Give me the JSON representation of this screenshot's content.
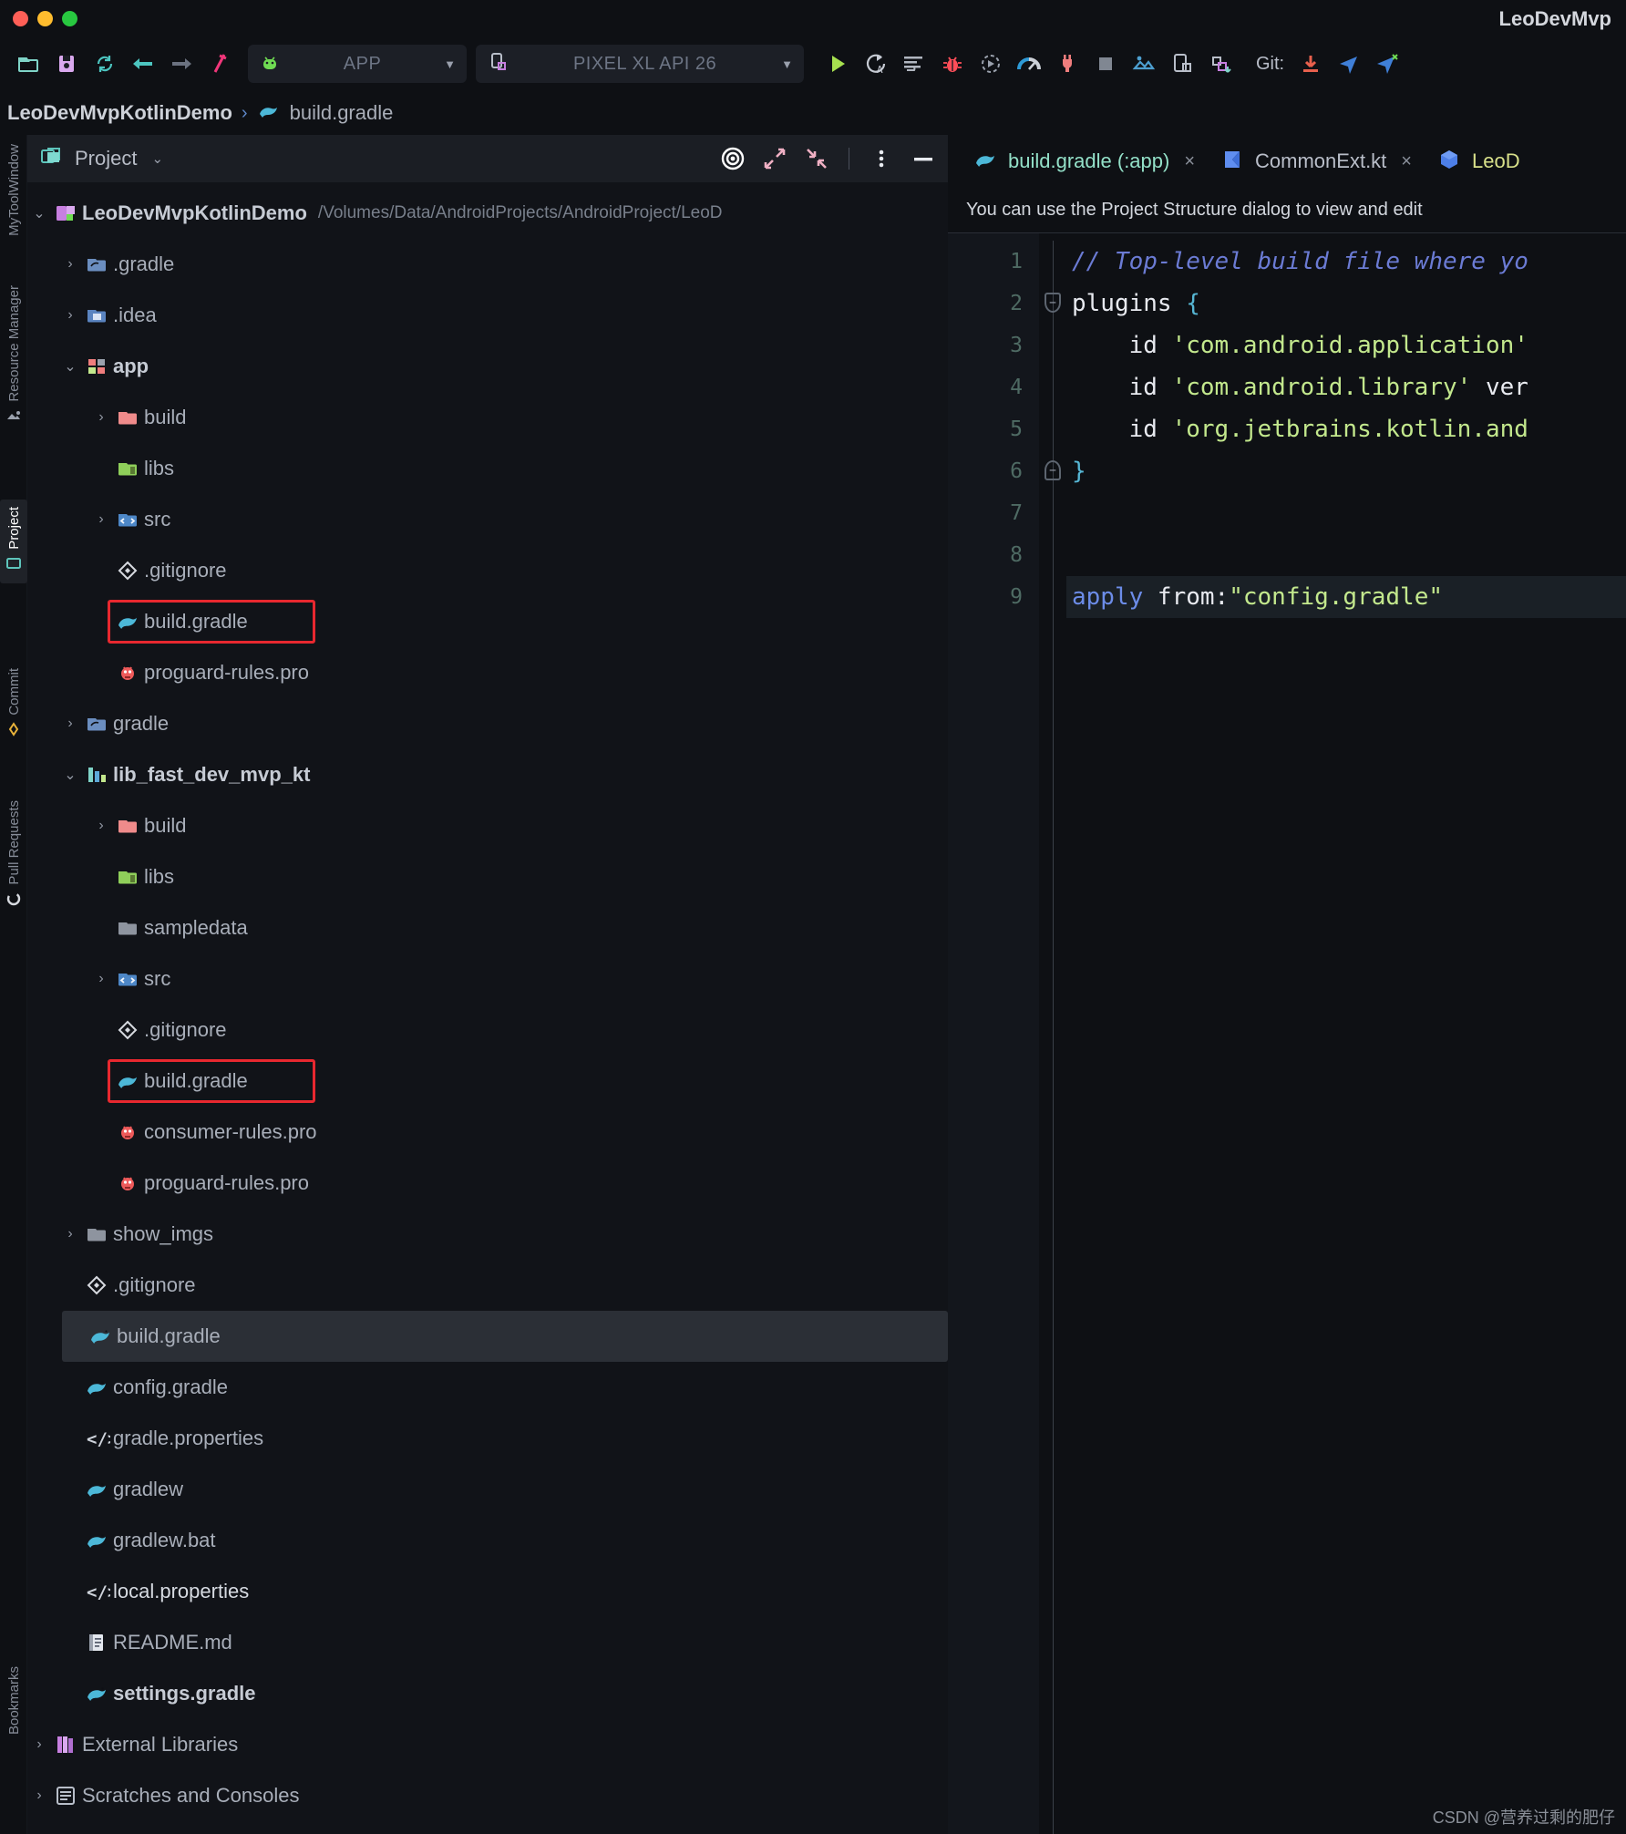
{
  "window": {
    "title": "LeoDevMvp"
  },
  "titlebar": {
    "close_label": "close",
    "minimize_label": "minimize",
    "maximize_label": "maximize"
  },
  "toolbar": {
    "icons": [
      {
        "name": "open-project-icon",
        "glyph": "folder"
      },
      {
        "name": "save-all-icon",
        "glyph": "save"
      },
      {
        "name": "sync-project-icon",
        "glyph": "sync"
      },
      {
        "name": "navigate-back-icon",
        "glyph": "arrow-left"
      },
      {
        "name": "navigate-forward-icon",
        "glyph": "arrow-right"
      },
      {
        "name": "sdk-manager-icon",
        "glyph": "hammer"
      }
    ],
    "app_config": {
      "label": "APP",
      "icon": "android-icon"
    },
    "device": {
      "label": "PIXEL XL API 26",
      "icon": "device-icon"
    },
    "run_icons": [
      {
        "name": "run-button",
        "glyph": "play"
      },
      {
        "name": "apply-changes-icon",
        "glyph": "apply-changes"
      },
      {
        "name": "apply-code-changes-icon",
        "glyph": "code-changes"
      },
      {
        "name": "debug-button",
        "glyph": "bug"
      },
      {
        "name": "attach-debugger-icon",
        "glyph": "attach"
      },
      {
        "name": "profiler-icon",
        "glyph": "gauge"
      },
      {
        "name": "logcat-icon",
        "glyph": "plug"
      },
      {
        "name": "stop-button",
        "glyph": "stop"
      },
      {
        "name": "device-manager-icon",
        "glyph": "device-mgr"
      },
      {
        "name": "layout-inspector-icon",
        "glyph": "layout"
      },
      {
        "name": "device-explorer-icon",
        "glyph": "device-explorer"
      }
    ],
    "git_label": "Git:",
    "git_icons": [
      {
        "name": "git-update-icon",
        "glyph": "download"
      },
      {
        "name": "git-push-icon",
        "glyph": "push"
      },
      {
        "name": "git-history-icon",
        "glyph": "history"
      }
    ]
  },
  "breadcrumb": {
    "project": "LeoDevMvpKotlinDemo",
    "separator": "›",
    "file": "build.gradle"
  },
  "toolstrip": {
    "items": [
      {
        "label": "MyToolWindow",
        "icon": "tool-window-icon",
        "selected": false
      },
      {
        "label": "Resource Manager",
        "icon": "resource-manager-icon",
        "selected": false
      },
      {
        "label": "Project",
        "icon": "project-icon",
        "selected": true
      },
      {
        "label": "Commit",
        "icon": "commit-icon",
        "selected": false
      },
      {
        "label": "Pull Requests",
        "icon": "pull-requests-icon",
        "selected": false
      },
      {
        "label": "Bookmarks",
        "icon": "bookmarks-icon",
        "selected": false
      }
    ]
  },
  "project_panel": {
    "title": "Project",
    "dropdown_caret": "⌄",
    "actions": [
      {
        "name": "select-opened-file-icon",
        "glyph": "target"
      },
      {
        "name": "expand-all-icon",
        "glyph": "expand"
      },
      {
        "name": "collapse-all-icon",
        "glyph": "collapse"
      },
      {
        "name": "more-options-icon",
        "glyph": "dots"
      },
      {
        "name": "hide-panel-icon",
        "glyph": "minus"
      }
    ],
    "tree": [
      {
        "depth": 0,
        "arrow": "down",
        "icon": "module-icon",
        "name": "LeoDevMvpKotlinDemo",
        "bold": true,
        "path": "/Volumes/Data/AndroidProjects/AndroidProject/LeoD"
      },
      {
        "depth": 1,
        "arrow": "right",
        "icon": "gradle-folder-icon",
        "name": ".gradle"
      },
      {
        "depth": 1,
        "arrow": "right",
        "icon": "idea-folder-icon",
        "name": ".idea"
      },
      {
        "depth": 1,
        "arrow": "down",
        "icon": "app-module-icon",
        "name": "app",
        "bold": true
      },
      {
        "depth": 2,
        "arrow": "right",
        "icon": "build-folder-icon",
        "name": "build"
      },
      {
        "depth": 2,
        "arrow": "none",
        "icon": "libs-folder-icon",
        "name": "libs"
      },
      {
        "depth": 2,
        "arrow": "right",
        "icon": "src-folder-icon",
        "name": "src"
      },
      {
        "depth": 2,
        "arrow": "none",
        "icon": "gitignore-icon",
        "name": ".gitignore"
      },
      {
        "depth": 2,
        "arrow": "none",
        "icon": "gradle-file-icon",
        "name": "build.gradle",
        "highlight_box": true
      },
      {
        "depth": 2,
        "arrow": "none",
        "icon": "proguard-icon",
        "name": "proguard-rules.pro"
      },
      {
        "depth": 1,
        "arrow": "right",
        "icon": "gradle-folder-icon",
        "name": "gradle"
      },
      {
        "depth": 1,
        "arrow": "down",
        "icon": "library-module-icon",
        "name": "lib_fast_dev_mvp_kt",
        "bold": true
      },
      {
        "depth": 2,
        "arrow": "right",
        "icon": "build-folder-icon",
        "name": "build"
      },
      {
        "depth": 2,
        "arrow": "none",
        "icon": "libs-folder-icon",
        "name": "libs"
      },
      {
        "depth": 2,
        "arrow": "none",
        "icon": "folder-icon",
        "name": "sampledata"
      },
      {
        "depth": 2,
        "arrow": "right",
        "icon": "src-folder-icon",
        "name": "src"
      },
      {
        "depth": 2,
        "arrow": "none",
        "icon": "gitignore-icon",
        "name": ".gitignore"
      },
      {
        "depth": 2,
        "arrow": "none",
        "icon": "gradle-file-icon",
        "name": "build.gradle",
        "highlight_box": true
      },
      {
        "depth": 2,
        "arrow": "none",
        "icon": "proguard-icon",
        "name": "consumer-rules.pro"
      },
      {
        "depth": 2,
        "arrow": "none",
        "icon": "proguard-icon",
        "name": "proguard-rules.pro"
      },
      {
        "depth": 1,
        "arrow": "right",
        "icon": "folder-icon",
        "name": "show_imgs"
      },
      {
        "depth": 1,
        "arrow": "none",
        "icon": "gitignore-icon",
        "name": ".gitignore"
      },
      {
        "depth": 1,
        "arrow": "none",
        "icon": "gradle-file-icon",
        "name": "build.gradle",
        "selected": true
      },
      {
        "depth": 1,
        "arrow": "none",
        "icon": "gradle-file-icon",
        "name": "config.gradle"
      },
      {
        "depth": 1,
        "arrow": "none",
        "icon": "properties-icon",
        "name": "gradle.properties"
      },
      {
        "depth": 1,
        "arrow": "none",
        "icon": "gradle-file-icon",
        "name": "gradlew"
      },
      {
        "depth": 1,
        "arrow": "none",
        "icon": "gradle-file-icon",
        "name": "gradlew.bat"
      },
      {
        "depth": 1,
        "arrow": "none",
        "icon": "properties-icon",
        "name": "local.properties",
        "bright": true
      },
      {
        "depth": 1,
        "arrow": "none",
        "icon": "readme-icon",
        "name": "README.md"
      },
      {
        "depth": 1,
        "arrow": "none",
        "icon": "gradle-file-icon",
        "name": "settings.gradle",
        "bold": true
      },
      {
        "depth": 0,
        "arrow": "right",
        "icon": "external-libraries-icon",
        "name": "External Libraries"
      },
      {
        "depth": 0,
        "arrow": "right",
        "icon": "scratches-icon",
        "name": "Scratches and Consoles"
      }
    ]
  },
  "editor": {
    "tabs": [
      {
        "label": "build.gradle (:app)",
        "icon": "gradle-file-icon",
        "active": true,
        "close": "×"
      },
      {
        "label": "CommonExt.kt",
        "icon": "kotlin-file-icon",
        "active": false,
        "close": "×"
      },
      {
        "label": "LeoD",
        "icon": "android-class-icon",
        "active": false,
        "close": ""
      }
    ],
    "notice": "You can use the Project Structure dialog to view and edit",
    "lines": [
      {
        "num": "1",
        "fold": "none",
        "tokens": [
          {
            "t": "comment",
            "v": "// Top-level build file where yo"
          }
        ]
      },
      {
        "num": "2",
        "fold": "top",
        "tokens": [
          {
            "t": "plain",
            "v": "plugins "
          },
          {
            "t": "brace",
            "v": "{"
          }
        ]
      },
      {
        "num": "3",
        "fold": "none",
        "tokens": [
          {
            "t": "plain",
            "v": "    id "
          },
          {
            "t": "string",
            "v": "'com.android.application'"
          }
        ]
      },
      {
        "num": "4",
        "fold": "none",
        "tokens": [
          {
            "t": "plain",
            "v": "    id "
          },
          {
            "t": "string",
            "v": "'com.android.library'"
          },
          {
            "t": "plain",
            "v": " ver"
          }
        ]
      },
      {
        "num": "5",
        "fold": "none",
        "tokens": [
          {
            "t": "plain",
            "v": "    id "
          },
          {
            "t": "string",
            "v": "'org.jetbrains.kotlin.and"
          }
        ]
      },
      {
        "num": "6",
        "fold": "bottom",
        "tokens": [
          {
            "t": "brace",
            "v": "}"
          }
        ]
      },
      {
        "num": "7",
        "fold": "none",
        "tokens": []
      },
      {
        "num": "8",
        "fold": "none",
        "tokens": []
      },
      {
        "num": "9",
        "fold": "none",
        "highlight": true,
        "tokens": [
          {
            "t": "keyword",
            "v": "apply"
          },
          {
            "t": "plain",
            "v": " from:"
          },
          {
            "t": "string",
            "v": "\"config.gradle\""
          }
        ]
      }
    ]
  },
  "watermark": "CSDN @营养过剩的肥仔",
  "colors": {
    "accent_red": "#e8282f",
    "selection": "#2b2f36",
    "gradle_icon": "#4cb8d8",
    "string": "#c3e88d",
    "comment": "#6b7bd4",
    "keyword": "#6c8ce8"
  }
}
